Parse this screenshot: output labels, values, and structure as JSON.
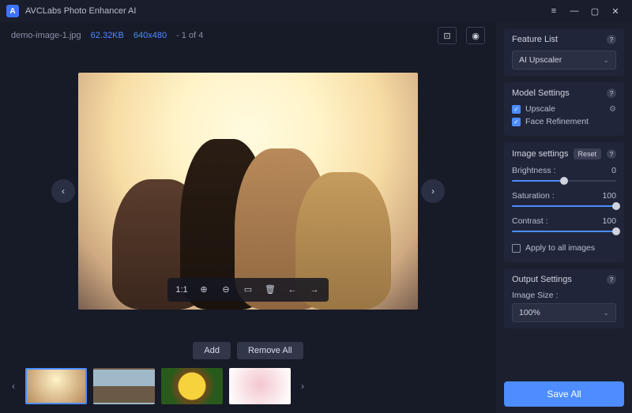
{
  "app": {
    "title": "AVCLabs Photo Enhancer AI"
  },
  "info": {
    "filename": "demo-image-1.jpg",
    "filesize": "62.32KB",
    "dimensions": "640x480",
    "counter": "- 1 of 4"
  },
  "stage_toolbar": {
    "ratio": "1:1"
  },
  "thumb_actions": {
    "add": "Add",
    "remove_all": "Remove All"
  },
  "thumbs": [
    {
      "selected": true
    },
    {
      "selected": false
    },
    {
      "selected": false
    },
    {
      "selected": false
    }
  ],
  "side": {
    "feature_list": {
      "title": "Feature List",
      "selected": "AI Upscaler"
    },
    "model_settings": {
      "title": "Model Settings",
      "upscale": {
        "label": "Upscale",
        "checked": true
      },
      "face": {
        "label": "Face Refinement",
        "checked": true
      }
    },
    "image_settings": {
      "title": "Image settings",
      "reset": "Reset",
      "brightness": {
        "label": "Brightness :",
        "value": "0",
        "pct": 50
      },
      "saturation": {
        "label": "Saturation :",
        "value": "100",
        "pct": 100
      },
      "contrast": {
        "label": "Contrast :",
        "value": "100",
        "pct": 100
      },
      "apply_all": {
        "label": "Apply to all images",
        "checked": false
      }
    },
    "output": {
      "title": "Output Settings",
      "size_label": "Image Size :",
      "size_value": "100%"
    },
    "save_all": "Save All"
  }
}
